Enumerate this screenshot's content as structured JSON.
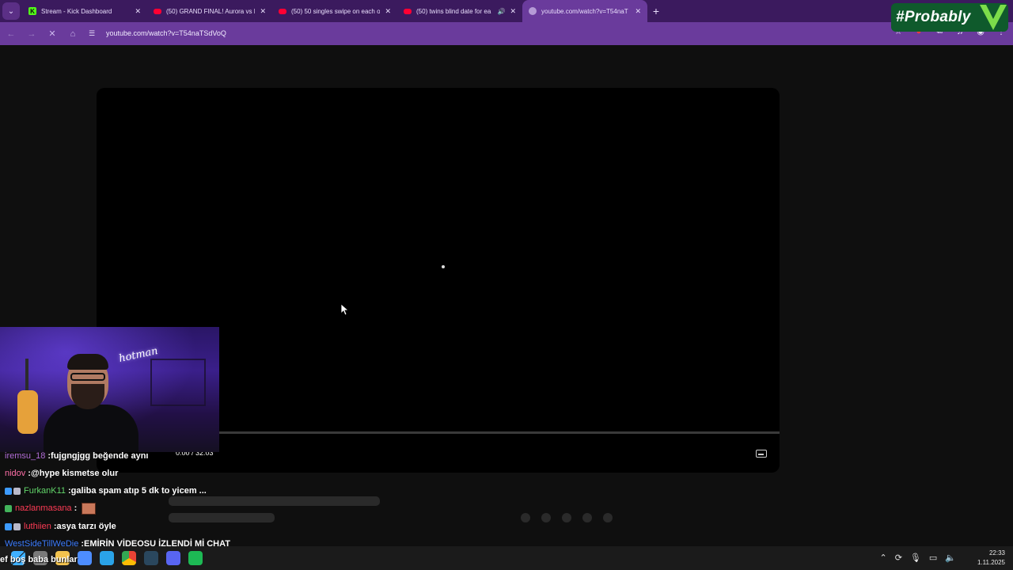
{
  "browser": {
    "tabs": [
      {
        "title": "Stream - Kick Dashboard",
        "icon": "kick-icon",
        "active": false
      },
      {
        "title": "(50) GRAND FINAL! Aurora vs L",
        "icon": "youtube-icon",
        "active": false
      },
      {
        "title": "(50) 50 singles swipe on each o",
        "icon": "youtube-icon",
        "active": false
      },
      {
        "title": "(50) twins blind date for ea",
        "icon": "youtube-icon",
        "active": false,
        "audio": "🔊"
      },
      {
        "title": "youtube.com/watch?v=T54naT",
        "icon": "globe-icon",
        "active": true
      }
    ],
    "new_tab": "+",
    "url": "youtube.com/watch?v=T54naTSdVoQ",
    "accent": "#6a3b9c"
  },
  "badge": {
    "text": "#Probably"
  },
  "player": {
    "time": "0:00 / 32:03"
  },
  "chat": [
    {
      "user": "iremsu_18",
      "user_color": "#b06bd8",
      "text": "fujgngjgg beğende aynı",
      "badges": []
    },
    {
      "user": "nidov",
      "user_color": "#ff6fa8",
      "text": "@hype kismetse olur",
      "badges": []
    },
    {
      "user": "FurkanK11",
      "user_color": "#62d66a",
      "text": "galiba spam atıp 5 dk to yicem ...",
      "badges": [
        "blue",
        "gray"
      ]
    },
    {
      "user": "nazlanmasana",
      "user_color": "#ff3b55",
      "text": "",
      "badges": [
        "green"
      ],
      "emote": true
    },
    {
      "user": "luthiien",
      "user_color": "#ff3b55",
      "text": "asya tarzı öyle",
      "badges": [
        "blue",
        "gray"
      ]
    },
    {
      "user": "WestSideTillWeDie",
      "user_color": "#3d7dff",
      "text": "EMİRİN VİDEOSU İZLENDİ Mİ CHAT",
      "badges": []
    }
  ],
  "overlay_text": "ef boş baba bunlar",
  "taskbar": {
    "time": "22:33",
    "date": "1.11.2025"
  }
}
